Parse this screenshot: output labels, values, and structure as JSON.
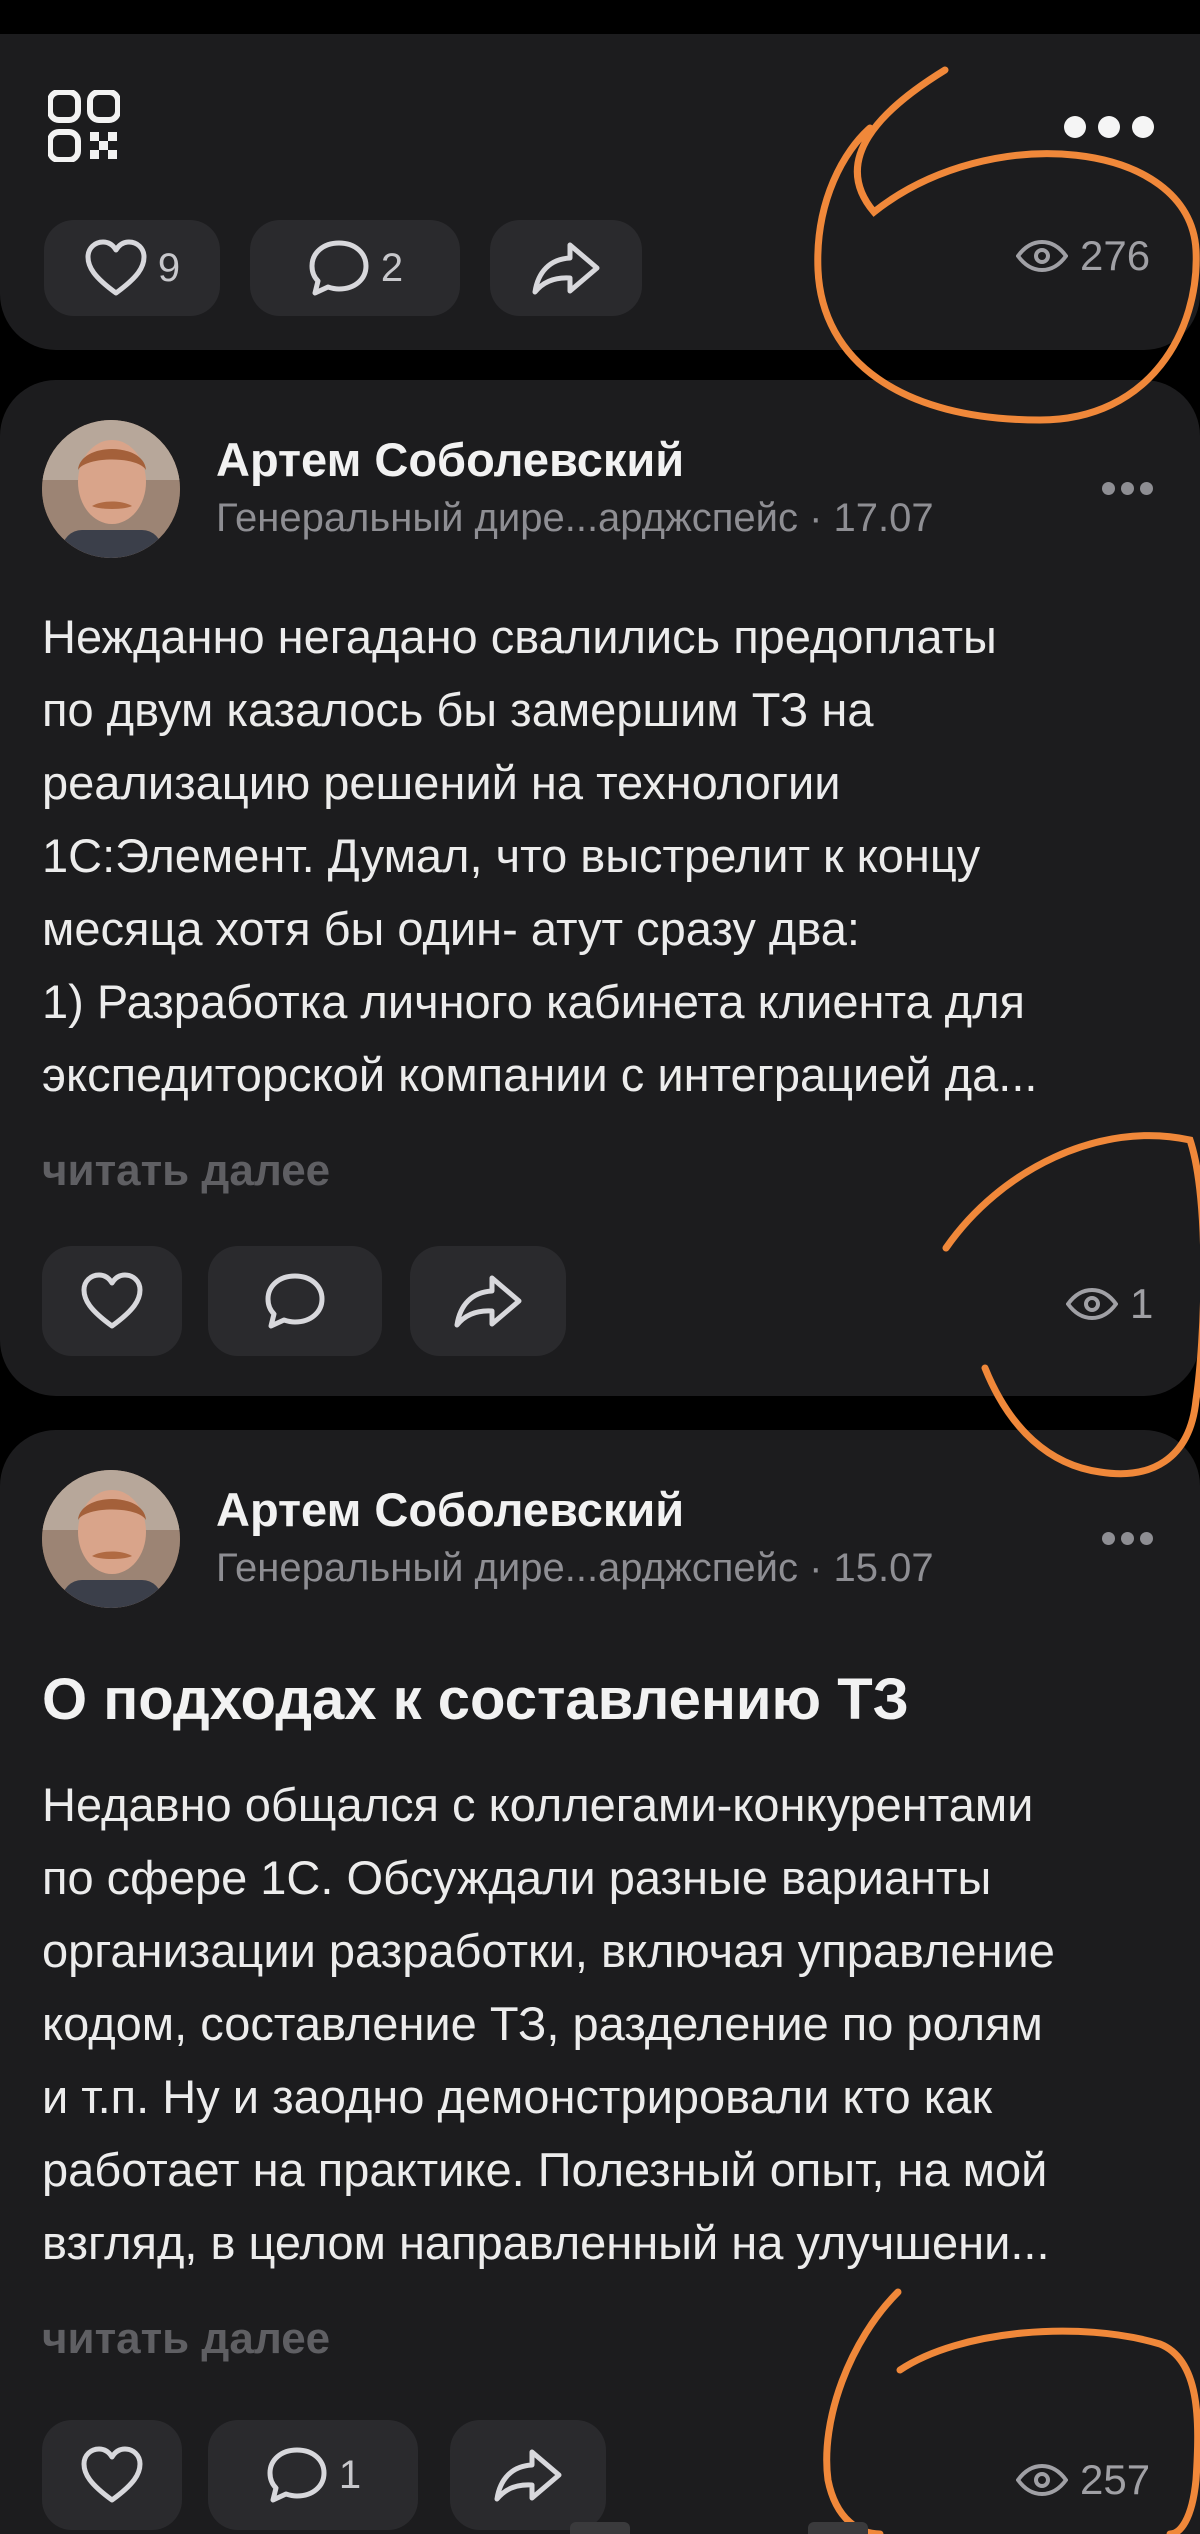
{
  "top_card": {
    "likes": "9",
    "comments": "2",
    "views": "276"
  },
  "post1": {
    "author": "Артем Соболевский",
    "subtitle": "Генеральный дире...арджспейс · 17.07",
    "lines": [
      "Нежданно негадано свалились предоплаты",
      "по двум казалось бы замершим ТЗ на",
      "реализацию решений на технологии",
      "1С:Элемент. Думал, что выстрелит к концу",
      "месяца хотя бы один- атут сразу два:",
      "1) Разработка личного кабинета клиента для",
      "экспедиторской компании с интеграцией да..."
    ],
    "read_more": "читать далее",
    "views": "1"
  },
  "post2": {
    "author": "Артем Соболевский",
    "subtitle": "Генеральный дире...арджспейс · 15.07",
    "title": "О подходах к составлению ТЗ",
    "lines": [
      "Недавно общался с коллегами-конкурентами",
      "по сфере 1С. Обсуждали разные варианты",
      "организации разработки, включая управление",
      "кодом, составление ТЗ, разделение по ролям",
      "и т.п. Ну и заодно демонстрировали кто как",
      "работает на практике. Полезный опыт, на мой",
      "взгляд, в целом направленный на улучшени..."
    ],
    "read_more": "читать далее",
    "comments": "1",
    "views": "257"
  },
  "colors": {
    "background": "#000000",
    "card": "#1c1c1e",
    "button": "#2a2a2d",
    "annotation": "#f0883a"
  }
}
